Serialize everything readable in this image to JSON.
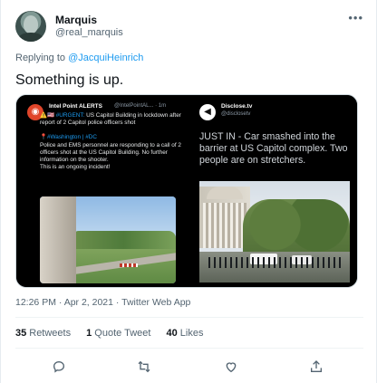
{
  "tweet": {
    "author": {
      "name": "Marquis",
      "handle": "@real_marquis"
    },
    "more_icon": "more-horizontal-icon",
    "reply_prefix": "Replying to ",
    "reply_to": "@JacquiHeinrich",
    "text": "Something is up.",
    "timestamp": "12:26 PM · Apr 2, 2021 · Twitter Web App"
  },
  "media": {
    "left": {
      "source_name": "Intel Point ALERTS",
      "source_handle": "@IntelPointAL... · 1m",
      "headline_prefix": "⚠️🇺🇸 ",
      "headline_tag": "#URGENT:",
      "headline": " US Capitol Building in lockdown after report of 2 Capitol police officers shot",
      "location_tags": "📍#Washington | #DC",
      "body": "Police and EMS personnel are responding to a call of 2 officers shot at the US Capitol Building. No further information on the shooter.",
      "footer": "This is an ongoing incident!"
    },
    "right": {
      "source_name": "Disclose.tv",
      "source_handle": "@disclosetv",
      "text": "JUST IN - Car smashed into the barrier at US Capitol complex. Two people are on stretchers."
    }
  },
  "stats": {
    "retweets_count": "35",
    "retweets_label": "Retweets",
    "quotes_count": "1",
    "quotes_label": "Quote Tweet",
    "likes_count": "40",
    "likes_label": "Likes"
  },
  "actions": [
    "reply-icon",
    "retweet-icon",
    "like-icon",
    "share-icon"
  ],
  "colors": {
    "link": "#1d9bf0",
    "muted": "#536471",
    "text": "#0f1419"
  }
}
